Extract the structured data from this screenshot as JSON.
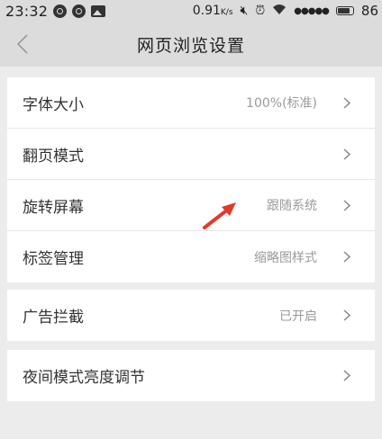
{
  "status_bar": {
    "time": "23:32",
    "net_speed": "0.91",
    "net_speed_unit": "K/s",
    "battery_level": "86",
    "left_icons": [
      "sync-icon",
      "sync-icon",
      "image-icon"
    ],
    "right_icons": [
      "mute-icon",
      "alarm-icon",
      "wifi-icon",
      "signal-icon",
      "battery-icon"
    ]
  },
  "nav": {
    "title": "网页浏览设置",
    "back_icon": "chevron-left-icon"
  },
  "groups": [
    {
      "rows": [
        {
          "label": "字体大小",
          "value": "100%(标准)"
        },
        {
          "label": "翻页模式",
          "value": ""
        },
        {
          "label": "旋转屏幕",
          "value": "跟随系统"
        },
        {
          "label": "标签管理",
          "value": "缩略图样式"
        }
      ]
    },
    {
      "rows": [
        {
          "label": "广告拦截",
          "value": "已开启"
        }
      ]
    },
    {
      "rows": [
        {
          "label": "夜间模式亮度调节",
          "value": ""
        }
      ]
    }
  ],
  "colors": {
    "background": "#ececec",
    "header": "#dcdcdc",
    "card": "#ffffff",
    "annotation_arrow": "#e03a2a"
  }
}
